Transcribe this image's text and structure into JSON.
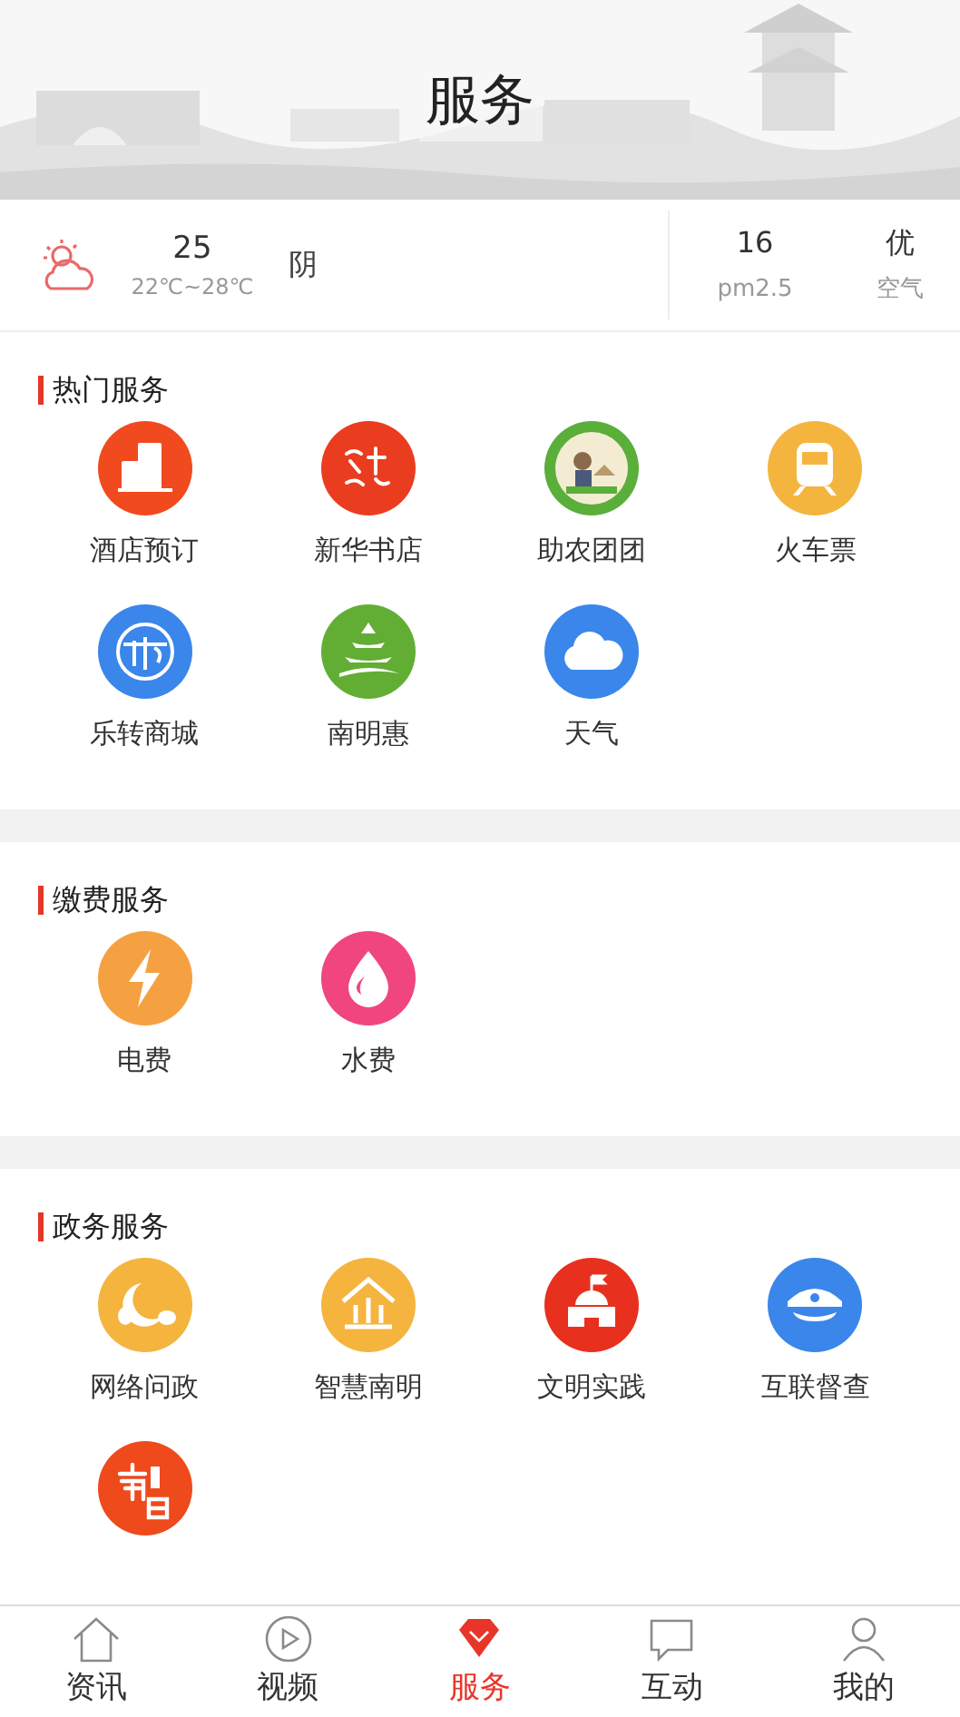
{
  "header": {
    "title": "服务"
  },
  "weather": {
    "temperature": "25",
    "range": "22℃~28℃",
    "condition": "阴",
    "pm_value": "16",
    "pm_label": "pm2.5",
    "air_value": "优",
    "air_label": "空气"
  },
  "sections": [
    {
      "title": "热门服务",
      "items": [
        {
          "label": "酒店预订",
          "kind": "hotel",
          "color": "#f04a1e"
        },
        {
          "label": "新华书店",
          "kind": "bookstore",
          "color": "#ea3d1f"
        },
        {
          "label": "助农团团",
          "kind": "farm",
          "color": "#5aae3a"
        },
        {
          "label": "火车票",
          "kind": "train",
          "color": "#f4b53f"
        },
        {
          "label": "乐转商城",
          "kind": "mall",
          "color": "#3a86ea"
        },
        {
          "label": "南明惠",
          "kind": "pagoda",
          "color": "#62ae34"
        },
        {
          "label": "天气",
          "kind": "cloud",
          "color": "#3a86ea"
        }
      ]
    },
    {
      "title": "缴费服务",
      "items": [
        {
          "label": "电费",
          "kind": "bolt",
          "color": "#f5a142"
        },
        {
          "label": "水费",
          "kind": "drop",
          "color": "#f0457f"
        }
      ]
    },
    {
      "title": "政务服务",
      "items": [
        {
          "label": "网络问政",
          "kind": "swirl",
          "color": "#f4b43e"
        },
        {
          "label": "智慧南明",
          "kind": "house",
          "color": "#f4b43e"
        },
        {
          "label": "文明实践",
          "kind": "flag",
          "color": "#e8301f"
        },
        {
          "label": "互联督查",
          "kind": "cap",
          "color": "#3a86ea"
        },
        {
          "kind": "seal",
          "color": "#ee4a1c"
        }
      ]
    }
  ],
  "tabs": [
    {
      "label": "资讯",
      "kind": "home",
      "selected": false
    },
    {
      "label": "视频",
      "kind": "play",
      "selected": false
    },
    {
      "label": "服务",
      "kind": "gem",
      "selected": true
    },
    {
      "label": "互动",
      "kind": "chat",
      "selected": false
    },
    {
      "label": "我的",
      "kind": "person",
      "selected": false
    }
  ]
}
